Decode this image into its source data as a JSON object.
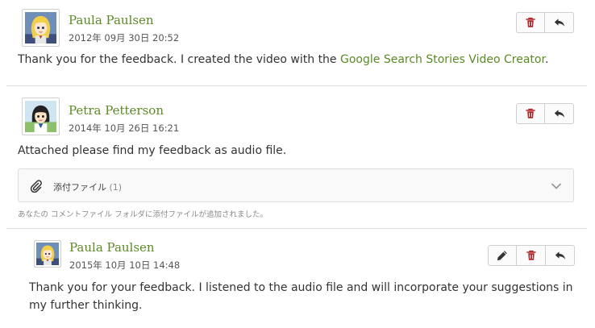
{
  "colors": {
    "link": "#5b8a25",
    "delete": "#b0242b",
    "text": "#333333"
  },
  "comments": [
    {
      "author": "Paula Paulsen",
      "date": "2012年 09月 30日 20:52",
      "text_before": "Thank you for the feedback. I created the video with the ",
      "link": "Google Search Stories Video Creator",
      "text_after": ".",
      "avatar": "paula-avatar",
      "actions": [
        "delete-icon",
        "reply-icon"
      ]
    },
    {
      "author": "Petra Petterson",
      "date": "2014年 10月 26日 16:21",
      "text": "Attached please find my feedback as audio file.",
      "avatar": "petra-avatar",
      "actions": [
        "delete-icon",
        "reply-icon"
      ],
      "attachment": {
        "label": "添付ファイル",
        "count": "(1)",
        "note": "あなたの コメントファイル フォルダに添付ファイルが追加されました。"
      }
    },
    {
      "author": "Paula Paulsen",
      "date": "2015年 10月 10日 14:48",
      "text": "Thank you for your feedback. I listened to the audio file and will incorporate your suggestions in my further thinking.",
      "avatar": "paula-avatar",
      "actions": [
        "edit-icon",
        "delete-icon",
        "reply-icon"
      ]
    }
  ]
}
